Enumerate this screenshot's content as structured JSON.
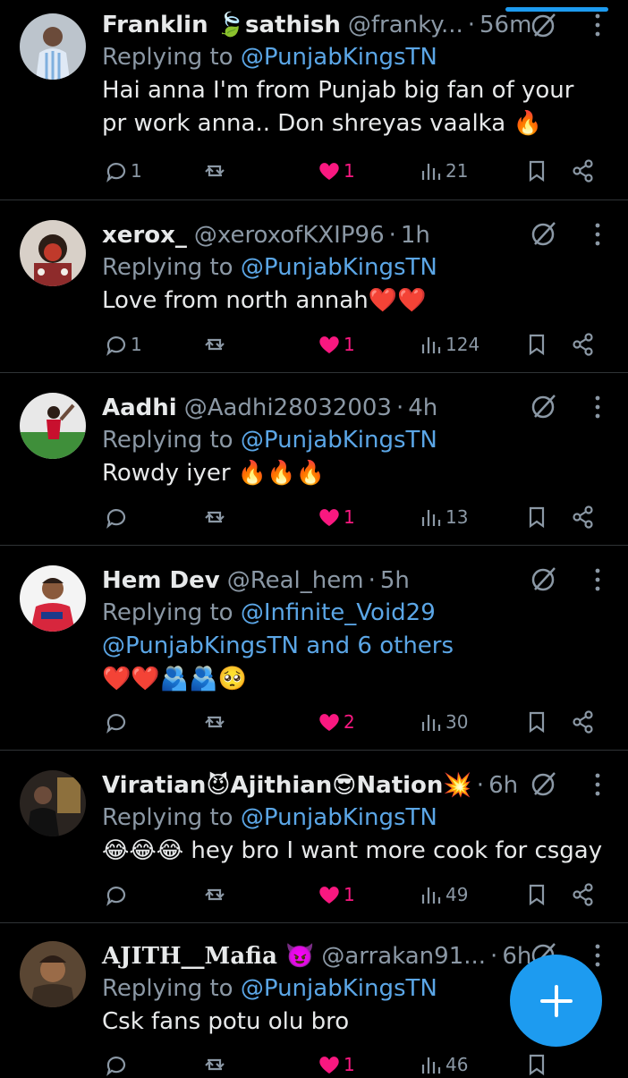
{
  "replies": [
    {
      "name": "Franklin 🍃sathish",
      "handle": "@franky...",
      "time": "56m",
      "replying_prefix": "Replying to ",
      "mentions": "@PunjabKingsTN",
      "mentions_line2": "",
      "text": "Hai anna I'm from Punjab big fan of your pr work anna.. Don shreyas vaalka 🔥",
      "comments": "1",
      "reposts": "",
      "likes": "1",
      "views": "21"
    },
    {
      "name": "xerox_",
      "handle": "@xeroxofKXIP96",
      "time": "1h",
      "replying_prefix": "Replying to ",
      "mentions": "@PunjabKingsTN",
      "mentions_line2": "",
      "text": "Love from north annah❤️❤️",
      "comments": "1",
      "reposts": "",
      "likes": "1",
      "views": "124"
    },
    {
      "name": "Aadhi",
      "handle": "@Aadhi28032003",
      "time": "4h",
      "replying_prefix": "Replying to ",
      "mentions": "@PunjabKingsTN",
      "mentions_line2": "",
      "text": "Rowdy iyer 🔥🔥🔥",
      "comments": "",
      "reposts": "",
      "likes": "1",
      "views": "13"
    },
    {
      "name": "Hem Dev",
      "handle": "@Real_hem",
      "time": "5h",
      "replying_prefix": "Replying to ",
      "mentions": "@Infinite_Void29",
      "mentions_line2": "@PunjabKingsTN and 6 others",
      "text": "❤️❤️🫂🫂🥺",
      "comments": "",
      "reposts": "",
      "likes": "2",
      "views": "30"
    },
    {
      "name": "Viratian😈Ajithian😎Nation💥",
      "handle": "",
      "time": "6h",
      "replying_prefix": "Replying to ",
      "mentions": "@PunjabKingsTN",
      "mentions_line2": "",
      "text": "😂😂😂 hey bro I want more cook for csgay",
      "comments": "",
      "reposts": "",
      "likes": "1",
      "views": "49"
    },
    {
      "name": "AJITH__Mafia 😈",
      "handle": "@arrakan91...",
      "time": "6h",
      "replying_prefix": "Replying to ",
      "mentions": "@PunjabKingsTN",
      "mentions_line2": "",
      "text": "Csk fans potu olu bro",
      "comments": "",
      "reposts": "",
      "likes": "1",
      "views": "46"
    }
  ],
  "colors": {
    "background": "#000000",
    "accent": "#1d9bf0",
    "mention": "#5ba6e6",
    "like": "#f91880",
    "muted": "#8b98a5",
    "divider": "#2f3336"
  },
  "icons": {
    "comment": "comment-icon",
    "repost": "repost-icon",
    "like": "heart-icon",
    "views": "views-icon",
    "bookmark": "bookmark-icon",
    "share": "share-icon",
    "grok": "grok-icon",
    "more": "more-icon",
    "compose": "plus-icon"
  }
}
